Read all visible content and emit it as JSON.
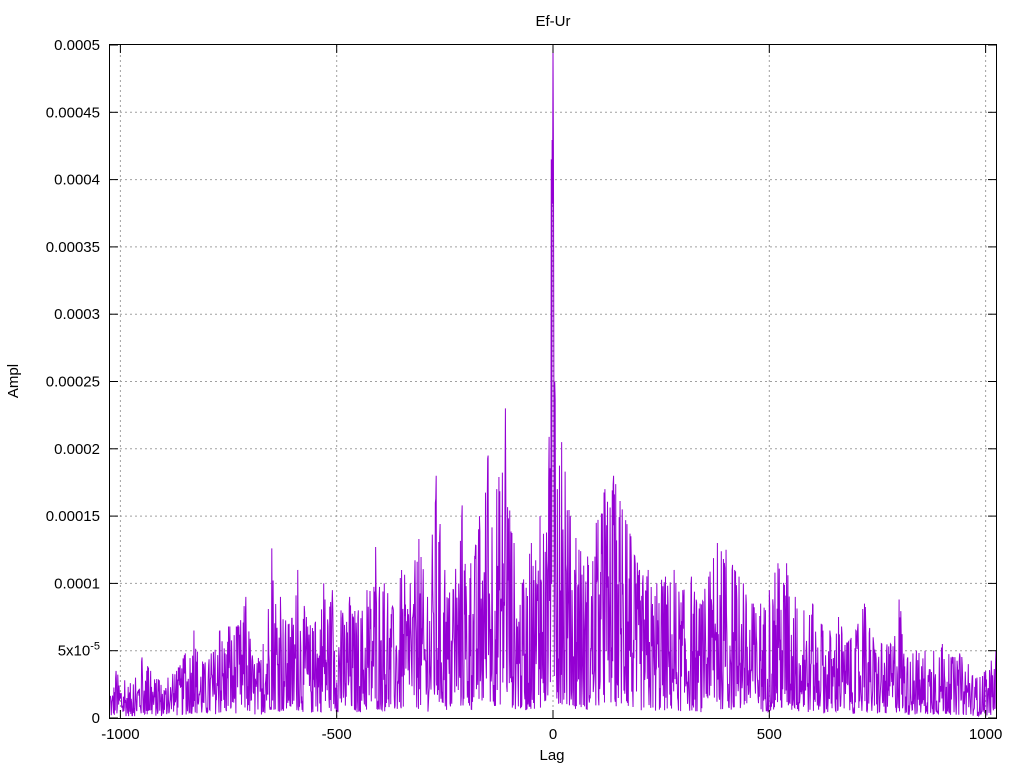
{
  "chart_data": {
    "type": "line",
    "title": "Ef-Ur",
    "xlabel": "Lag",
    "ylabel": "Ampl",
    "xlim": [
      -1024,
      1024
    ],
    "ylim": [
      0,
      0.0005
    ],
    "grid": true,
    "legend": "none",
    "color": "#9400d3",
    "xticks": [
      {
        "value": -1000,
        "label": "-1000"
      },
      {
        "value": -500,
        "label": "-500"
      },
      {
        "value": 0,
        "label": "0"
      },
      {
        "value": 500,
        "label": "500"
      },
      {
        "value": 1000,
        "label": "1000"
      }
    ],
    "yticks": [
      {
        "value": 0,
        "label": "0"
      },
      {
        "value": 5e-05,
        "label": "5x10",
        "sup": "-5"
      },
      {
        "value": 0.0001,
        "label": "0.0001"
      },
      {
        "value": 0.00015,
        "label": "0.00015"
      },
      {
        "value": 0.0002,
        "label": "0.0002"
      },
      {
        "value": 0.00025,
        "label": "0.00025"
      },
      {
        "value": 0.0003,
        "label": "0.0003"
      },
      {
        "value": 0.00035,
        "label": "0.00035"
      },
      {
        "value": 0.0004,
        "label": "0.0004"
      },
      {
        "value": 0.00045,
        "label": "0.00045"
      },
      {
        "value": 0.0005,
        "label": "0.0005"
      }
    ],
    "series": [
      {
        "values_note_x": "lag",
        "peaks": [
          [
            -1024,
            1.5e-05
          ],
          [
            -1010,
            3.5e-05
          ],
          [
            -990,
            2.8e-05
          ],
          [
            -970,
            2.5e-05
          ],
          [
            -950,
            4.5e-05
          ],
          [
            -930,
            3.5e-05
          ],
          [
            -910,
            2.8e-05
          ],
          [
            -890,
            3e-05
          ],
          [
            -870,
            3.5e-05
          ],
          [
            -850,
            4.8e-05
          ],
          [
            -830,
            6.5e-05
          ],
          [
            -810,
            4.2e-05
          ],
          [
            -790,
            4.8e-05
          ],
          [
            -770,
            6.5e-05
          ],
          [
            -750,
            6.8e-05
          ],
          [
            -730,
            6.8e-05
          ],
          [
            -710,
            9e-05
          ],
          [
            -690,
            4e-05
          ],
          [
            -670,
            5.5e-05
          ],
          [
            -650,
            0.000126
          ],
          [
            -630,
            9e-05
          ],
          [
            -610,
            7e-05
          ],
          [
            -590,
            0.00011
          ],
          [
            -570,
            7.5e-05
          ],
          [
            -550,
            7e-05
          ],
          [
            -530,
            0.0001
          ],
          [
            -510,
            9.5e-05
          ],
          [
            -490,
            8e-05
          ],
          [
            -470,
            9e-05
          ],
          [
            -450,
            8e-05
          ],
          [
            -430,
            9.5e-05
          ],
          [
            -410,
            0.000127
          ],
          [
            -390,
            0.0001
          ],
          [
            -370,
            8.2e-05
          ],
          [
            -350,
            0.00011
          ],
          [
            -330,
            0.0001
          ],
          [
            -310,
            0.000133
          ],
          [
            -290,
            9e-05
          ],
          [
            -270,
            0.00018
          ],
          [
            -250,
            0.00011
          ],
          [
            -230,
            9.5e-05
          ],
          [
            -210,
            0.000158
          ],
          [
            -190,
            0.000115
          ],
          [
            -170,
            0.00015
          ],
          [
            -150,
            0.000195
          ],
          [
            -130,
            0.00017
          ],
          [
            -110,
            0.00023
          ],
          [
            -90,
            0.00013
          ],
          [
            -70,
            0.0001
          ],
          [
            -50,
            0.00013
          ],
          [
            -30,
            0.00015
          ],
          [
            -10,
            0.000175
          ],
          [
            -4,
            0.000415
          ],
          [
            0,
            0.0005
          ],
          [
            4,
            0.00025
          ],
          [
            10,
            0.00017
          ],
          [
            20,
            0.000205
          ],
          [
            40,
            0.00015
          ],
          [
            60,
            0.000125
          ],
          [
            80,
            0.00012
          ],
          [
            100,
            0.000145
          ],
          [
            120,
            0.00017
          ],
          [
            140,
            0.00018
          ],
          [
            160,
            0.000155
          ],
          [
            180,
            0.000135
          ],
          [
            200,
            0.00011
          ],
          [
            220,
            0.00011
          ],
          [
            240,
            0.0001
          ],
          [
            260,
            0.000105
          ],
          [
            280,
            0.00011
          ],
          [
            300,
            9.5e-05
          ],
          [
            320,
            0.000105
          ],
          [
            340,
            8.5e-05
          ],
          [
            360,
            0.000105
          ],
          [
            380,
            0.00013
          ],
          [
            400,
            0.000125
          ],
          [
            420,
            0.00011
          ],
          [
            440,
            0.0001
          ],
          [
            460,
            8.5e-05
          ],
          [
            480,
            8.5e-05
          ],
          [
            500,
            9.5e-05
          ],
          [
            520,
            0.000115
          ],
          [
            540,
            0.000115
          ],
          [
            560,
            9e-05
          ],
          [
            580,
            8e-05
          ],
          [
            600,
            8.5e-05
          ],
          [
            620,
            7e-05
          ],
          [
            640,
            6.5e-05
          ],
          [
            660,
            7.5e-05
          ],
          [
            680,
            5.5e-05
          ],
          [
            700,
            6.5e-05
          ],
          [
            720,
            8.5e-05
          ],
          [
            740,
            6e-05
          ],
          [
            760,
            5.5e-05
          ],
          [
            780,
            5.5e-05
          ],
          [
            800,
            8.8e-05
          ],
          [
            820,
            4.5e-05
          ],
          [
            840,
            5e-05
          ],
          [
            860,
            5e-05
          ],
          [
            880,
            5e-05
          ],
          [
            900,
            5.5e-05
          ],
          [
            920,
            4.5e-05
          ],
          [
            940,
            4.8e-05
          ],
          [
            960,
            4e-05
          ],
          [
            980,
            3e-05
          ],
          [
            1000,
            3.5e-05
          ],
          [
            1024,
            5e-05
          ]
        ]
      }
    ]
  }
}
